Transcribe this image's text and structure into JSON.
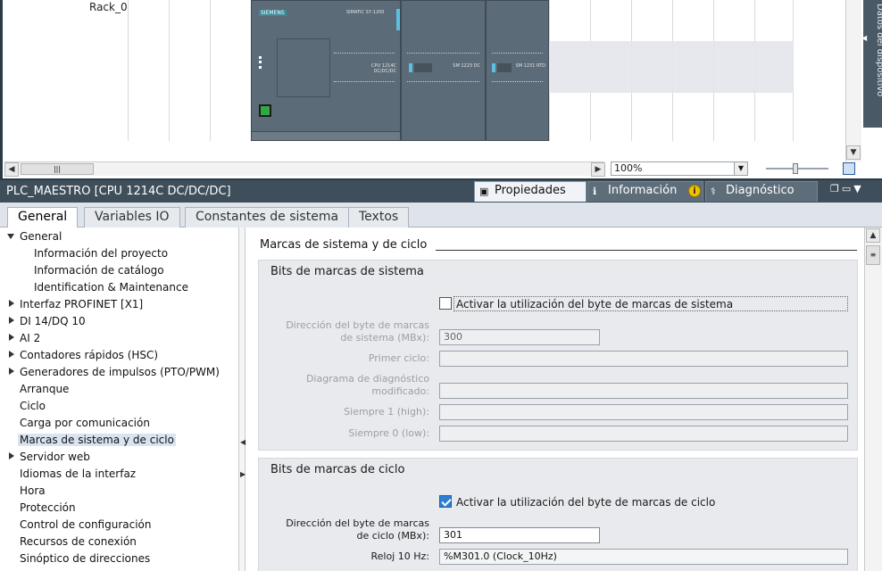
{
  "device_view": {
    "rack_label": "Rack_0",
    "side_tab": "Datos del dispositivo",
    "zoom": "100%",
    "modules": {
      "cpu_brand": "SIEMENS",
      "cpu_model": "SIMATIC S7-1200",
      "cpu_label": "CPU 1214C DC/DC/DC",
      "sm1_label": "SM 1223 DC",
      "sm2_label": "SM 1231 RTD"
    }
  },
  "properties": {
    "title": "PLC_MAESTRO [CPU 1214C DC/DC/DC]",
    "tabs": [
      {
        "label": "Propiedades",
        "icon": "properties-icon"
      },
      {
        "label": "Información",
        "icon": "info-icon"
      },
      {
        "label": "Diagnóstico",
        "icon": "diagnostics-icon"
      }
    ],
    "info_badge": "i"
  },
  "subtabs": [
    "General",
    "Variables IO",
    "Constantes de sistema",
    "Textos"
  ],
  "tree": {
    "items": [
      {
        "label": "General"
      },
      {
        "label": "Información del proyecto"
      },
      {
        "label": "Información de catálogo"
      },
      {
        "label": "Identification & Maintenance"
      },
      {
        "label": "Interfaz PROFINET [X1]"
      },
      {
        "label": "DI 14/DQ 10"
      },
      {
        "label": "AI 2"
      },
      {
        "label": "Contadores rápidos (HSC)"
      },
      {
        "label": "Generadores de impulsos (PTO/PWM)"
      },
      {
        "label": "Arranque"
      },
      {
        "label": "Ciclo"
      },
      {
        "label": "Carga por comunicación"
      },
      {
        "label": "Marcas de sistema y de ciclo"
      },
      {
        "label": "Servidor web"
      },
      {
        "label": "Idiomas de la interfaz"
      },
      {
        "label": "Hora"
      },
      {
        "label": "Protección"
      },
      {
        "label": "Control de configuración"
      },
      {
        "label": "Recursos de conexión"
      },
      {
        "label": "Sinóptico de direcciones"
      }
    ]
  },
  "content": {
    "section_title": "Marcas de sistema y de ciclo",
    "system_bits": {
      "title": "Bits de marcas de sistema",
      "enable_label": "Activar la utilización del byte de marcas de sistema",
      "enabled": false,
      "address_label_1": "Dirección del byte de marcas",
      "address_label_2": "de sistema (MBx):",
      "address_value": "300",
      "first_cycle_label": "Primer ciclo:",
      "first_cycle_value": "",
      "diag_label_1": "Diagrama de diagnóstico",
      "diag_label_2": "modificado:",
      "diag_value": "",
      "always1_label": "Siempre 1 (high):",
      "always1_value": "",
      "always0_label": "Siempre 0 (low):",
      "always0_value": ""
    },
    "clock_bits": {
      "title": "Bits de marcas de ciclo",
      "enable_label": "Activar la utilización del byte de marcas de ciclo",
      "enabled": true,
      "address_label_1": "Dirección del byte de marcas",
      "address_label_2": "de ciclo (MBx):",
      "address_value": "301",
      "clock10_label": "Reloj 10 Hz:",
      "clock10_value": "%M301.0 (Clock_10Hz)"
    }
  },
  "colors": {
    "header_bg": "#3f4e5b",
    "module_gray": "#5c6b78",
    "checkbox_blue": "#2f7fd1",
    "selection": "#d9e4f0"
  }
}
